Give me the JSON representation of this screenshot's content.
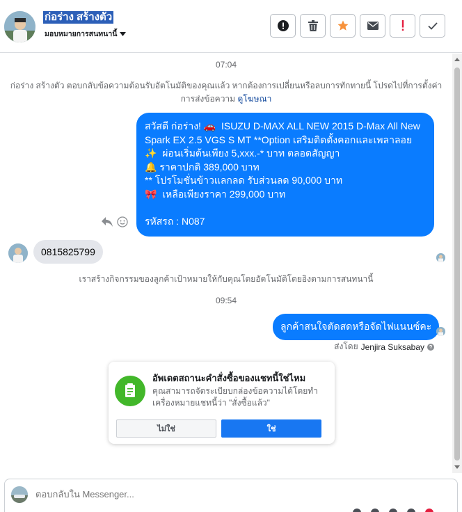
{
  "header": {
    "contact_name": "ก่อร่าง สร้างตัว",
    "assign_label": "มอบหมายการสนทนานี้",
    "toolbar": [
      {
        "name": "spam-button",
        "icon": "alert-circle-icon",
        "color": "#1c1e21"
      },
      {
        "name": "delete-button",
        "icon": "trash-icon",
        "color": "#444950"
      },
      {
        "name": "star-button",
        "icon": "star-icon",
        "color": "#f7923b"
      },
      {
        "name": "mark-unread-button",
        "icon": "envelope-icon",
        "color": "#444950"
      },
      {
        "name": "follow-up-button",
        "icon": "exclamation-icon",
        "color": "#e41e3f"
      },
      {
        "name": "done-button",
        "icon": "checkmark-icon",
        "color": "#444950"
      }
    ]
  },
  "conversation": {
    "time1": "07:04",
    "system_notice": "ก่อร่าง สร้างตัว ตอบกลับข้อความต้อนรับอัตโนมัติของคุณแล้ว หากต้องการเปลี่ยนหรือลบการทักทายนี้ โปรดไปที่การตั้งค่าการส่งข้อความ",
    "system_link": "ดูโฆษณา",
    "outgoing_lines": [
      "สวัสดี ก่อร่าง! 🚗  ISUZU D-MAX ALL NEW 2015 D-Max All New Spark EX 2.5 VGS S MT **Option เสริมติดตั้งคอกและเพลาลอย",
      "✨  ผ่อนเริ่มต้นเพียง 5,xxx.-* บาท ตลอดสัญญา",
      "🔔 ราคาปกติ 389,000 บาท",
      "** โปรโมชั่นข้าวแลกลด รับส่วนลด 90,000 บาท",
      "🎀  เหลือเพียงราคา 299,000 บาท",
      "",
      "รหัสรถ : N087"
    ],
    "incoming_message": "0815825799",
    "activity_notice": "เราสร้างกิจกรรมของลูกค้าเป้าหมายให้กับคุณโดยอัตโนมัติโดยอิงตามการสนทนานี้",
    "time2": "09:54",
    "outgoing_message2": "ลูกค้าสนใจตัดสดหรือจัดไฟแนนซ์คะ",
    "sent_by_label": "ส่งโดย",
    "sent_by_name": "Jenjira Suksabay"
  },
  "card": {
    "title": "อัพเดตสถานะคำสั่งซื้อของแชทนี้ใช่ไหม",
    "description": "คุณสามารถจัดระเบียบกล่องข้อความได้โดยทำเครื่องหมายแชทนี้ว่า \"สั่งซื้อแล้ว\"",
    "no_label": "ไม่ใช่",
    "yes_label": "ใช่",
    "icon": "receipt-icon"
  },
  "composer": {
    "placeholder": "ตอบกลับใน Messenger..."
  }
}
